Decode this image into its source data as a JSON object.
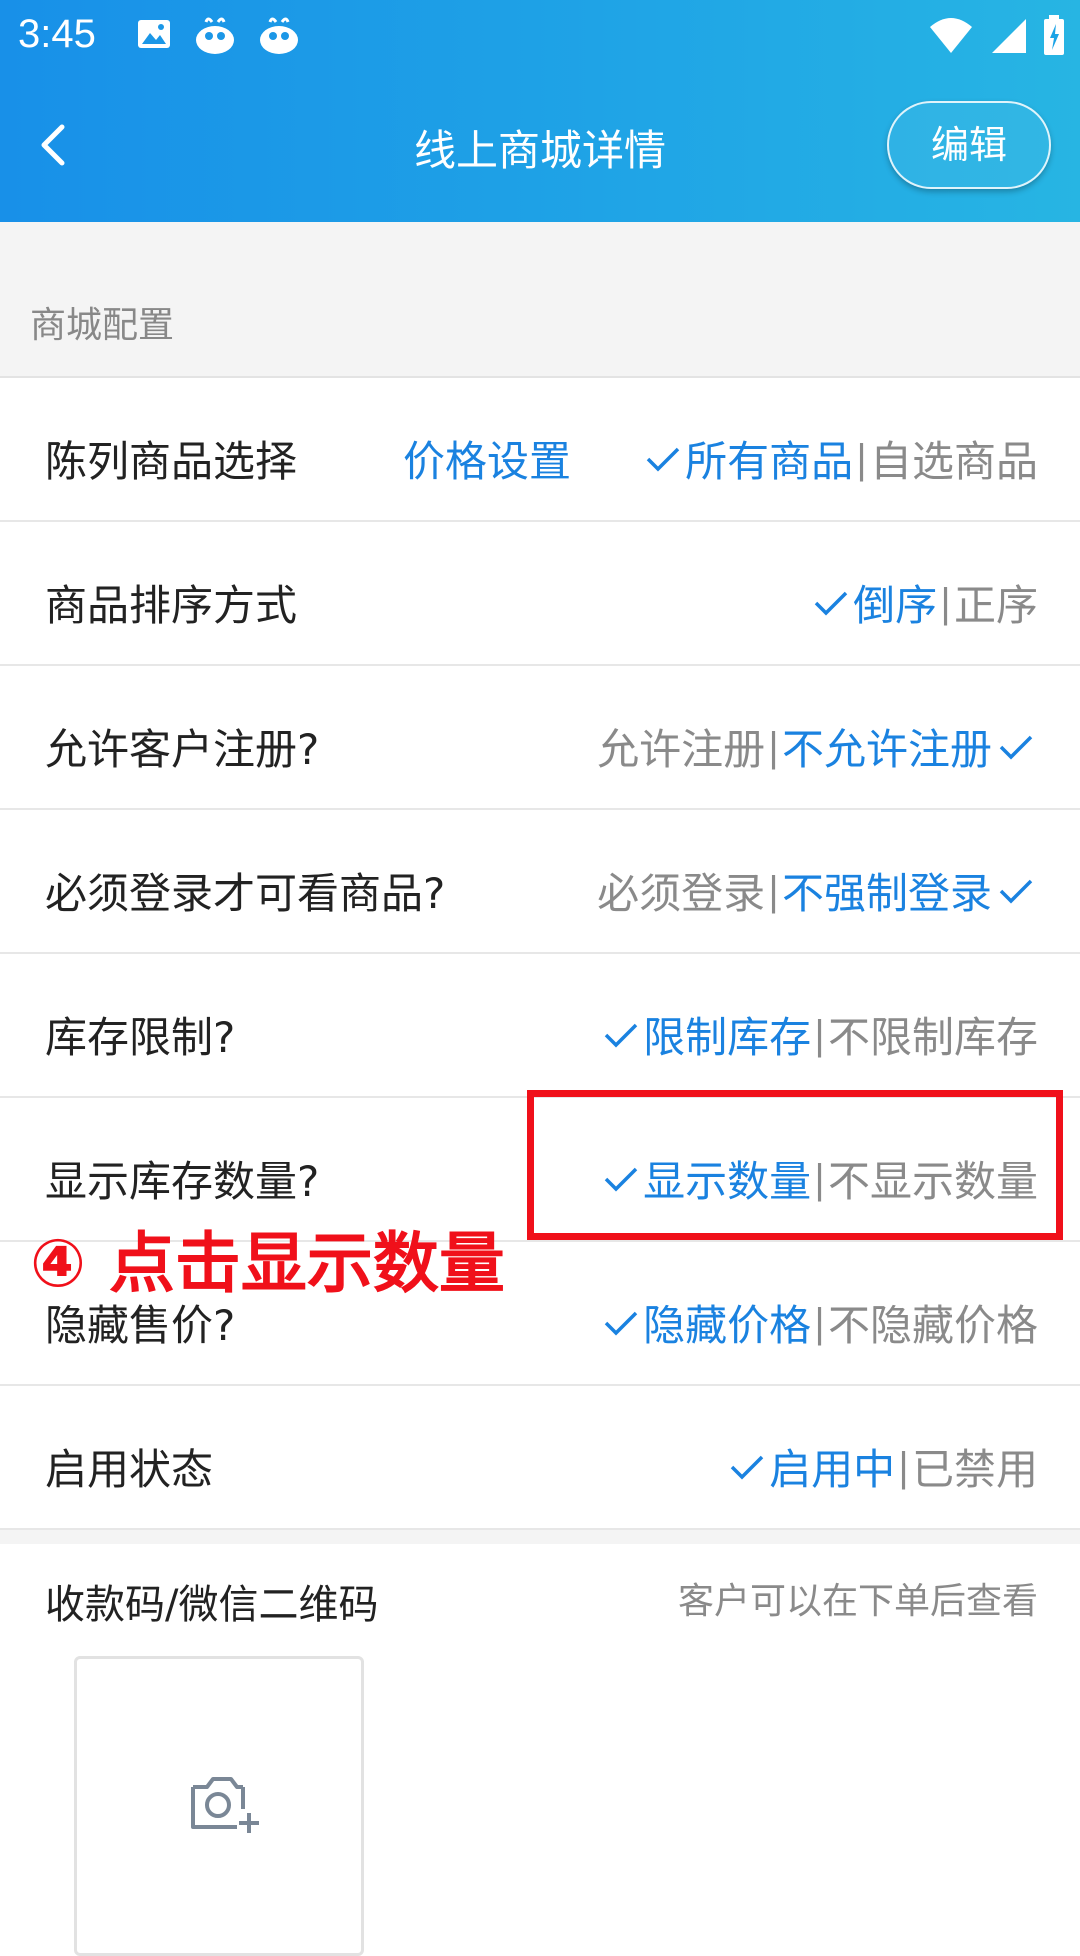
{
  "status_bar": {
    "time": "3:45"
  },
  "header": {
    "title": "线上商城详情",
    "edit_label": "编辑"
  },
  "section": {
    "title": "商城配置"
  },
  "rows": [
    {
      "label": "陈列商品选择",
      "extra": "价格设置",
      "options": [
        {
          "text": "所有商品",
          "selected": true
        },
        {
          "text": "自选商品",
          "selected": false
        }
      ]
    },
    {
      "label": "商品排序方式",
      "options": [
        {
          "text": "倒序",
          "selected": true
        },
        {
          "text": "正序",
          "selected": false
        }
      ]
    },
    {
      "label": "允许客户注册?",
      "options": [
        {
          "text": "允许注册",
          "selected": false
        },
        {
          "text": "不允许注册",
          "selected": true
        }
      ]
    },
    {
      "label": "必须登录才可看商品?",
      "options": [
        {
          "text": "必须登录",
          "selected": false
        },
        {
          "text": "不强制登录",
          "selected": true
        }
      ]
    },
    {
      "label": "库存限制?",
      "options": [
        {
          "text": "限制库存",
          "selected": true
        },
        {
          "text": "不限制库存",
          "selected": false
        }
      ]
    },
    {
      "label": "显示库存数量?",
      "options": [
        {
          "text": "显示数量",
          "selected": true
        },
        {
          "text": "不显示数量",
          "selected": false
        }
      ]
    },
    {
      "label": "隐藏售价?",
      "options": [
        {
          "text": "隐藏价格",
          "selected": true
        },
        {
          "text": "不隐藏价格",
          "selected": false
        }
      ]
    },
    {
      "label": "启用状态",
      "options": [
        {
          "text": "启用中",
          "selected": true
        },
        {
          "text": "已禁用",
          "selected": false
        }
      ]
    }
  ],
  "separator": "|",
  "qr": {
    "label": "收款码/微信二维码",
    "hint": "客户可以在下单后查看"
  },
  "annotation": {
    "text": "④ 点击显示数量"
  },
  "colors": {
    "accent": "#1a82e0",
    "header_start": "#1890e8",
    "header_end": "#27b5e3",
    "annotation": "#f0101a",
    "inactive_text": "#8a8a8a"
  },
  "icons": [
    "image-icon",
    "app-icon",
    "wifi-icon",
    "signal-icon",
    "battery-icon",
    "back-arrow-icon",
    "check-icon",
    "camera-add-icon"
  ]
}
